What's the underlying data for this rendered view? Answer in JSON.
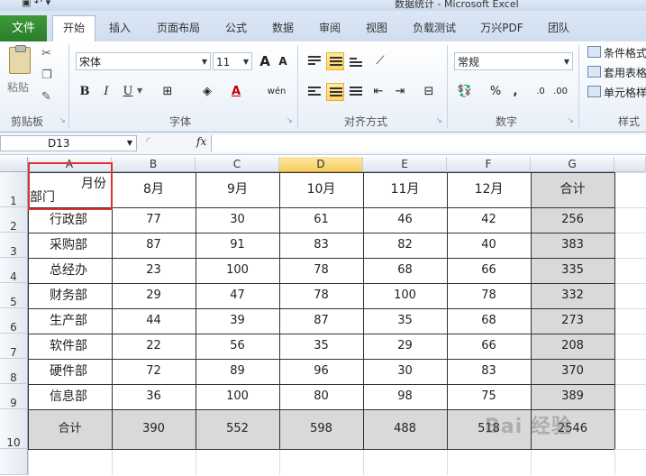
{
  "window": {
    "title": "数据统计 - Microsoft Excel"
  },
  "ribbon": {
    "file_tab": "文件",
    "tabs": [
      "开始",
      "插入",
      "页面布局",
      "公式",
      "数据",
      "审阅",
      "视图",
      "负载测试",
      "万兴PDF",
      "团队"
    ],
    "active_tab": "开始",
    "clipboard": {
      "paste_label": "粘贴",
      "group_label": "剪贴板"
    },
    "font": {
      "name": "宋体",
      "size": "11",
      "grow": "A",
      "shrink": "A",
      "bold": "B",
      "italic": "I",
      "underline": "U",
      "wen": "wén",
      "group_label": "字体"
    },
    "alignment": {
      "group_label": "对齐方式"
    },
    "number": {
      "format": "常规",
      "percent": "%",
      "comma": ",",
      "group_label": "数字"
    },
    "styles": {
      "conditional": "条件格式",
      "table": "套用表格",
      "cell": "单元格样",
      "group_label": "样式"
    }
  },
  "formula_bar": {
    "name_box": "D13",
    "fx_label": "fx",
    "value": ""
  },
  "colors": {
    "accent": "#2a7d2a",
    "selected_header": "#f8cd5f",
    "total_fill": "#d9d9d9",
    "highlight": "#e0322f"
  },
  "grid": {
    "columns": [
      "A",
      "B",
      "C",
      "D",
      "E",
      "F",
      "G"
    ],
    "rows": [
      "1",
      "2",
      "3",
      "4",
      "5",
      "6",
      "7",
      "8",
      "9",
      "10"
    ],
    "header_cell": {
      "top": "月份",
      "bottom": "部门"
    },
    "months": [
      "8月",
      "9月",
      "10月",
      "11月",
      "12月"
    ],
    "total_label": "合计",
    "departments": [
      {
        "name": "行政部",
        "values": [
          "77",
          "30",
          "61",
          "46",
          "42"
        ],
        "total": "256"
      },
      {
        "name": "采购部",
        "values": [
          "87",
          "91",
          "83",
          "82",
          "40"
        ],
        "total": "383"
      },
      {
        "name": "总经办",
        "values": [
          "23",
          "100",
          "78",
          "68",
          "66"
        ],
        "total": "335"
      },
      {
        "name": "财务部",
        "values": [
          "29",
          "47",
          "78",
          "100",
          "78"
        ],
        "total": "332"
      },
      {
        "name": "生产部",
        "values": [
          "44",
          "39",
          "87",
          "35",
          "68"
        ],
        "total": "273"
      },
      {
        "name": "软件部",
        "values": [
          "22",
          "56",
          "35",
          "29",
          "66"
        ],
        "total": "208"
      },
      {
        "name": "硬件部",
        "values": [
          "72",
          "89",
          "96",
          "30",
          "83"
        ],
        "total": "370"
      },
      {
        "name": "信息部",
        "values": [
          "36",
          "100",
          "80",
          "98",
          "75"
        ],
        "total": "389"
      }
    ],
    "totals_row": {
      "label": "合计",
      "values": [
        "390",
        "552",
        "598",
        "488",
        "518"
      ],
      "grand_total": "2546"
    }
  },
  "watermark": "Bai 经验"
}
